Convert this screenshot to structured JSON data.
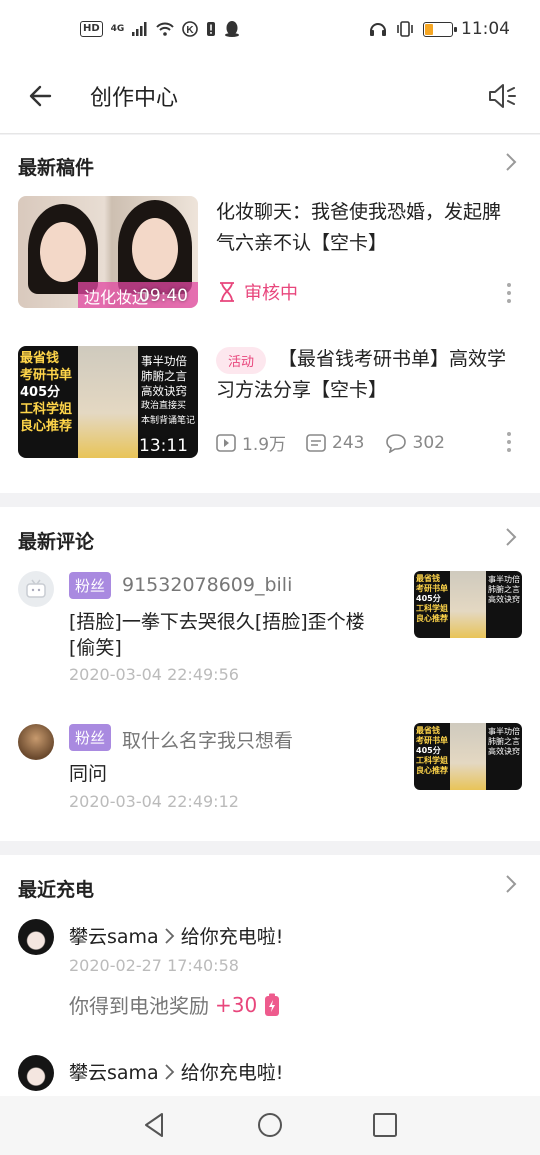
{
  "status_bar": {
    "hd": "HD",
    "net": "4G",
    "time": "11:04"
  },
  "header": {
    "title": "创作中心"
  },
  "latest_drafts": {
    "title": "最新稿件",
    "items": [
      {
        "title": "化妆聊天：我爸使我恐婚，发起脾气六亲不认【空卡】",
        "thumb_caption": "边化妆边",
        "duration": "09:40",
        "status": "审核中"
      },
      {
        "tag": "活动",
        "title": "【最省钱考研书单】高效学习方法分享【空卡】",
        "duration": "13:11",
        "views": "1.9万",
        "danmaku": "243",
        "comments": "302",
        "thumb_left": [
          "最省钱",
          "考研书单",
          "405分",
          "工科学姐",
          "良心推荐"
        ],
        "thumb_right": [
          "事半功倍",
          "肺腑之言",
          "高效诀窍",
          "政治直接买",
          "本制背诵笔记"
        ]
      }
    ]
  },
  "latest_comments": {
    "title": "最新评论",
    "items": [
      {
        "badge": "粉丝",
        "user": "91532078609_bili",
        "text": "[捂脸]一拳下去哭很久[捂脸]歪个楼[偷笑]",
        "time": "2020-03-04 22:49:56"
      },
      {
        "badge": "粉丝",
        "user": "取什么名字我只想看",
        "text": "同问",
        "time": "2020-03-04 22:49:12"
      }
    ]
  },
  "recent_charges": {
    "title": "最近充电",
    "items": [
      {
        "user": "攀云sama",
        "action": "给你充电啦!",
        "time": "2020-02-27 17:40:58",
        "reward_label": "你得到电池奖励",
        "reward_value": "+30"
      },
      {
        "user": "攀云sama",
        "action": "给你充电啦!"
      }
    ]
  },
  "colors": {
    "accent_pink": "#e8467c",
    "fan_badge": "#a98ae0"
  }
}
